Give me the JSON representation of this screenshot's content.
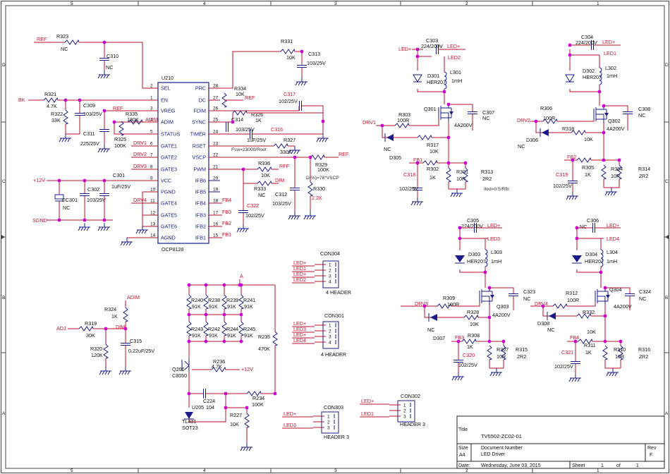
{
  "frame": {
    "col_labels": [
      "5",
      "4",
      "3",
      "2",
      "1"
    ],
    "row_labels": [
      "D",
      "C",
      "B",
      "A"
    ]
  },
  "title_block": {
    "title_label": "Title",
    "title": "TV5502-ZC02-01",
    "size_label": "Size",
    "size": "A4",
    "docnum_label": "Document Number",
    "doc_name": "LED Driver",
    "rev_label": "Rev",
    "rev": "F",
    "date_label": "Date:",
    "date": "Wednesday, June 03, 2015",
    "sheet_label": "Sheet",
    "sheet": "1",
    "of_label": "of",
    "of": "1"
  },
  "ic": {
    "ref": "U210",
    "part": "OCP8128",
    "left_pins": [
      {
        "num": "2",
        "name": "SEL"
      },
      {
        "num": "1",
        "name": "EN"
      },
      {
        "num": "3",
        "name": "VREG"
      },
      {
        "num": "4",
        "name": "ADIM"
      },
      {
        "num": "5",
        "name": "STATUS"
      },
      {
        "num": "6",
        "name": "GATE1"
      },
      {
        "num": "7",
        "name": "GATE2"
      },
      {
        "num": "8",
        "name": "GATE3"
      },
      {
        "num": "9",
        "name": "VCC"
      },
      {
        "num": "10",
        "name": "PGND"
      },
      {
        "num": "11",
        "name": "GATE4"
      },
      {
        "num": "12",
        "name": "GATE5"
      },
      {
        "num": "13",
        "name": "GATE6"
      },
      {
        "num": "14",
        "name": "AGND"
      }
    ],
    "right_pins": [
      {
        "num": "28",
        "name": "PRC"
      },
      {
        "num": "27",
        "name": "DC"
      },
      {
        "num": "26",
        "name": "FDIM"
      },
      {
        "num": "25",
        "name": "SYNC"
      },
      {
        "num": "24",
        "name": "TIMER"
      },
      {
        "num": "23",
        "name": "RSET"
      },
      {
        "num": "22",
        "name": "VSCP"
      },
      {
        "num": "21",
        "name": "PWM"
      },
      {
        "num": "20",
        "name": "IFB6"
      },
      {
        "num": "19",
        "name": "IFB5"
      },
      {
        "num": "18",
        "name": "IFB4"
      },
      {
        "num": "17",
        "name": "IFB3"
      },
      {
        "num": "16",
        "name": "IFB2"
      },
      {
        "num": "15",
        "name": "IFB1"
      }
    ]
  },
  "nets": {
    "ref": "REF",
    "bk": "BK",
    "plus12v": "+12V",
    "sgnd": "SGND",
    "adim": "ADIM",
    "adj": "ADJ",
    "dim": "DIM",
    "rff": "RFF",
    "a": "A",
    "drv1": "DRV1",
    "drv2": "DRV2",
    "drv3": "DRV3",
    "drv4": "DRV4",
    "fb1": "FB1",
    "fb2": "FB2",
    "fb3": "FB3",
    "fb4": "FB4",
    "led_plus": "LED+",
    "led1": "LED1",
    "led2": "LED2",
    "led3": "LED3",
    "led4": "LED4"
  },
  "notes": {
    "fsw": "Fsw=23000/Rset",
    "vscp": "D(%)=78*VSCP",
    "iled": "Iled=0.5/Rfb"
  },
  "parts": {
    "R323": {
      "ref": "R323",
      "val": "NC"
    },
    "C310": {
      "ref": "C310",
      "val": "NC"
    },
    "R321": {
      "ref": "R321",
      "val": "4.7K"
    },
    "R322": {
      "ref": "R322",
      "val": "33K"
    },
    "C309": {
      "ref": "C309",
      "val": "103/25V"
    },
    "C311": {
      "ref": "C311",
      "val": "225/25V"
    },
    "R335": {
      "ref": "R335",
      "val": "180K"
    },
    "R325": {
      "ref": "R325",
      "val": "100K"
    },
    "R331": {
      "ref": "R331",
      "val": "10K"
    },
    "C313": {
      "ref": "C313",
      "val": "103/25V"
    },
    "R334": {
      "ref": "R334",
      "val": "10K"
    },
    "C317": {
      "ref": "C317",
      "val": "102/25V"
    },
    "R326": {
      "ref": "R326",
      "val": "1K"
    },
    "C314": {
      "ref": "C314",
      "val": "103/25V"
    },
    "C316": {
      "ref": "C316",
      "val": "1uF/25V"
    },
    "R327": {
      "ref": "R327",
      "val": "330K"
    },
    "R329": {
      "ref": "R329",
      "val": "100K"
    },
    "R336": {
      "ref": "R336",
      "val": "10K"
    },
    "R333": {
      "ref": "R333",
      "val": "NC"
    },
    "C312": {
      "ref": "C312",
      "val": "103/25V"
    },
    "R330": {
      "ref": "R330",
      "val": "2.2K"
    },
    "C322": {
      "ref": "C322",
      "val": "102/25V"
    },
    "C301": {
      "ref": "C301",
      "val": "1uF/25V"
    },
    "C302": {
      "ref": "C302",
      "val": "103/25V"
    },
    "EC301": {
      "ref": "EC301",
      "val": "NC"
    },
    "C303": {
      "ref": "C303",
      "val": "224/200V"
    },
    "D301": {
      "ref": "D301",
      "val": "HER207"
    },
    "L301": {
      "ref": "L301",
      "val": "1mH"
    },
    "Q301": {
      "ref": "Q301",
      "val": "4A200V"
    },
    "C307": {
      "ref": "C307",
      "val": "NC"
    },
    "R303": {
      "ref": "R303",
      "val": "100R"
    },
    "D305": {
      "ref": "D305",
      "val": "NC"
    },
    "R317": {
      "ref": "R317",
      "val": "10K"
    },
    "R302": {
      "ref": "R302",
      "val": "1K"
    },
    "R301": {
      "ref": "R301",
      "val": "10R"
    },
    "R313": {
      "ref": "R313",
      "val": "2R2"
    },
    "C318": {
      "ref": "C318",
      "val": "102/25V"
    },
    "C304": {
      "ref": "C304",
      "val": "224/200V"
    },
    "D302": {
      "ref": "D302",
      "val": "HER207"
    },
    "L302": {
      "ref": "L302",
      "val": "1mH"
    },
    "Q302": {
      "ref": "Q302",
      "val": "4A200V"
    },
    "C308": {
      "ref": "C308",
      "val": "NC"
    },
    "R306": {
      "ref": "R306",
      "val": "100R"
    },
    "D306": {
      "ref": "D306",
      "val": "NC"
    },
    "R318": {
      "ref": "R318",
      "val": "10K"
    },
    "R305": {
      "ref": "R305",
      "val": "1K"
    },
    "R304": {
      "ref": "R304",
      "val": "10R"
    },
    "R314": {
      "ref": "R314",
      "val": "2R2"
    },
    "C319": {
      "ref": "C319",
      "val": "102/25V"
    },
    "C305": {
      "ref": "C305",
      "val": "224/200V"
    },
    "D303": {
      "ref": "D303",
      "val": "HER207"
    },
    "L303": {
      "ref": "L303",
      "val": "1mH"
    },
    "Q303": {
      "ref": "Q303",
      "val": "4A200V"
    },
    "C323": {
      "ref": "C323",
      "val": "NC"
    },
    "R309": {
      "ref": "R309",
      "val": "100R"
    },
    "D307": {
      "ref": "D307",
      "val": "NC"
    },
    "R328": {
      "ref": "R328",
      "val": "10K"
    },
    "R308": {
      "ref": "R308",
      "val": "1K"
    },
    "R307": {
      "ref": "R307",
      "val": "10R"
    },
    "R315": {
      "ref": "R315",
      "val": "2R2"
    },
    "C320": {
      "ref": "C320",
      "val": "102/25V"
    },
    "C306": {
      "ref": "C306",
      "val": "NC"
    },
    "D304": {
      "ref": "D304",
      "val": "HER207"
    },
    "L304": {
      "ref": "L304",
      "val": "1mH"
    },
    "Q304": {
      "ref": "Q304",
      "val": "4A200V"
    },
    "C324": {
      "ref": "C324",
      "val": "NC"
    },
    "R312": {
      "ref": "R312",
      "val": "100R"
    },
    "D308": {
      "ref": "D308",
      "val": "NC"
    },
    "R332": {
      "ref": "R332",
      "val": "10K"
    },
    "R311": {
      "ref": "R311",
      "val": "1K"
    },
    "R310": {
      "ref": "R310",
      "val": "10R"
    },
    "R316": {
      "ref": "R316",
      "val": "2R2"
    },
    "C321": {
      "ref": "C321",
      "val": "102/25V"
    },
    "R324": {
      "ref": "R324",
      "val": "1K"
    },
    "R319": {
      "ref": "R319",
      "val": "30K"
    },
    "R320": {
      "ref": "R320",
      "val": "120K"
    },
    "C315": {
      "ref": "C315",
      "val": "0.22uF/25V"
    },
    "R240": {
      "ref": "R240",
      "val": "91K"
    },
    "R238": {
      "ref": "R238",
      "val": "91K"
    },
    "R239": {
      "ref": "R239",
      "val": "91K"
    },
    "R241": {
      "ref": "R241",
      "val": "91K"
    },
    "R243": {
      "ref": "R243",
      "val": "91K"
    },
    "R242": {
      "ref": "R242",
      "val": "91K"
    },
    "R244": {
      "ref": "R244",
      "val": "91K"
    },
    "R245": {
      "ref": "R245",
      "val": "91K"
    },
    "R235": {
      "ref": "R235",
      "val": "470K"
    },
    "Q206": {
      "ref": "Q206",
      "val": "C8050"
    },
    "R236": {
      "ref": "R236",
      "val": "4.7K"
    },
    "C224": {
      "ref": "C224",
      "val": "104"
    },
    "U205": {
      "ref": "U205",
      "val": "TL431"
    },
    "U205pkg": {
      "ref": "",
      "val": "SOT23"
    },
    "R234": {
      "ref": "R234",
      "val": "100K"
    },
    "R227": {
      "ref": "R227",
      "val": "10K"
    }
  },
  "connectors": {
    "con304": {
      "ref": "CON304",
      "type": "4 HEADER",
      "pins": [
        "1",
        "2",
        "3",
        "4"
      ],
      "nets": [
        "LED+",
        "LED1",
        "LED+",
        "LED2"
      ]
    },
    "con301": {
      "ref": "CON301",
      "type": "4 HEADER",
      "pins": [
        "1",
        "2",
        "3",
        "4"
      ],
      "nets": [
        "LED+",
        "LED3",
        "LED+",
        "LED4"
      ]
    },
    "con303": {
      "ref": "CON303",
      "type": "HEADER 3",
      "pins": [
        "1",
        "2",
        "3"
      ],
      "nets": [
        "LED+",
        "LED3"
      ]
    },
    "con302": {
      "ref": "CON302",
      "type": "HEADER 3",
      "pins": [
        "1",
        "2",
        "3"
      ],
      "nets": [
        "LED+",
        "LED1"
      ]
    }
  }
}
